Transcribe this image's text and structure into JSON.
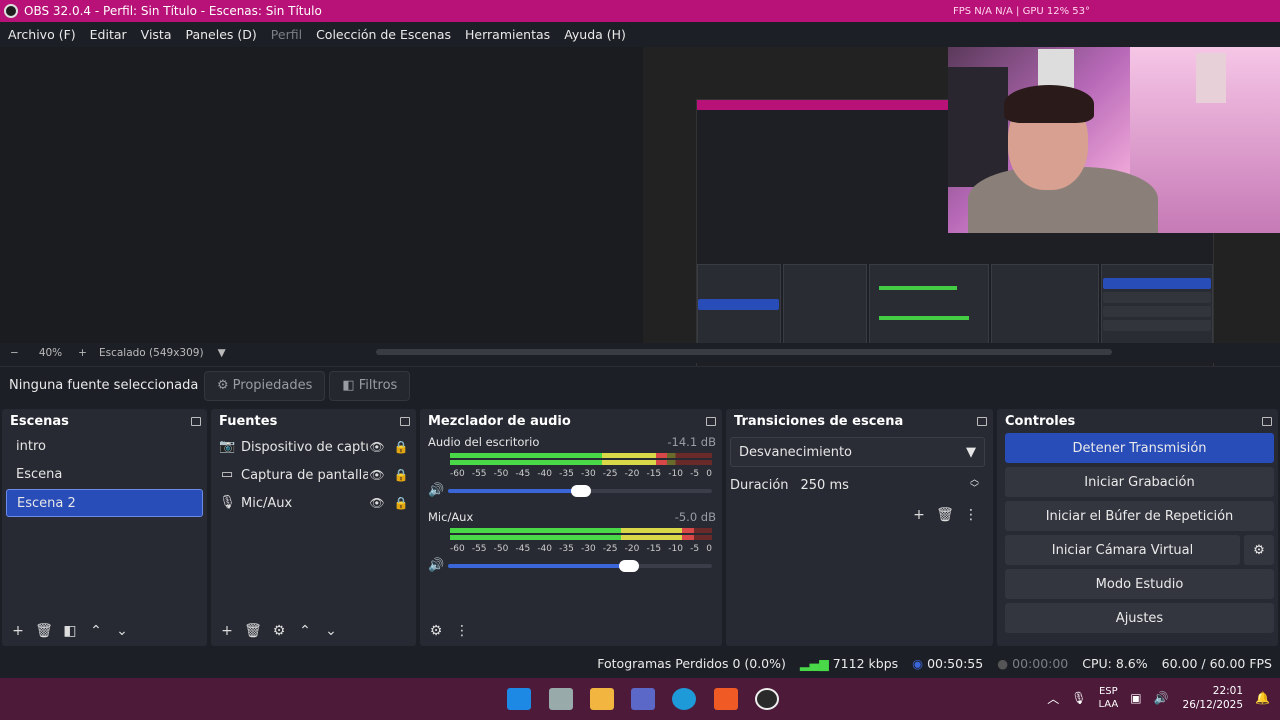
{
  "window": {
    "title": "OBS 32.0.4 - Perfil: Sin Título - Escenas: Sin Título",
    "fps": "FPS N/A N/A | GPU 12% 53°"
  },
  "menu": {
    "items": [
      "Archivo (F)",
      "Editar",
      "Vista",
      "Paneles (D)",
      "Perfil",
      "Colección de Escenas",
      "Herramientas",
      "Ayuda (H)"
    ]
  },
  "preview_bar": {
    "minus": "−",
    "zoom": "40%",
    "plus": "+",
    "scale": "Escalado (549x309)"
  },
  "context": {
    "no_source": "Ninguna fuente seleccionada",
    "properties": "Propiedades",
    "filters": "Filtros"
  },
  "scenes": {
    "title": "Escenas",
    "items": [
      "intro",
      "Escena",
      "Escena 2"
    ],
    "selected": 2
  },
  "sources": {
    "title": "Fuentes",
    "items": [
      {
        "label": "Dispositivo de captura de video",
        "icon": "camera-icon"
      },
      {
        "label": "Captura de pantalla",
        "icon": "monitor-icon"
      },
      {
        "label": "Mic/Aux",
        "icon": "microphone-icon"
      }
    ]
  },
  "mixer": {
    "title": "Mezclador de audio",
    "channels": [
      {
        "name": "Audio del escritorio",
        "db": "-14.1 dB",
        "level": 0.83,
        "volume": 0.56
      },
      {
        "name": "Mic/Aux",
        "db": "-5.0 dB",
        "level": 0.93,
        "volume": 0.76
      }
    ],
    "scale": [
      "-60",
      "-55",
      "-50",
      "-45",
      "-40",
      "-35",
      "-30",
      "-25",
      "-20",
      "-15",
      "-10",
      "-5",
      "0"
    ]
  },
  "transitions": {
    "title": "Transiciones de escena",
    "selected": "Desvanecimiento",
    "duration_label": "Duración",
    "duration": "250 ms"
  },
  "controls": {
    "title": "Controles",
    "buttons": [
      "Detener Transmisión",
      "Iniciar Grabación",
      "Iniciar el Búfer de Repetición",
      "Iniciar Cámara Virtual",
      "Modo Estudio",
      "Ajustes"
    ]
  },
  "status": {
    "dropped": "Fotogramas Perdidos 0 (0.0%)",
    "kbps": "7112 kbps",
    "stream_time": "00:50:55",
    "rec_time": "00:00:00",
    "cpu": "CPU: 8.6%",
    "fps": "60.00 / 60.00 FPS"
  },
  "taskbar": {
    "lang1": "ESP",
    "lang2": "LAA",
    "time": "22:01",
    "date": "26/12/2025"
  },
  "colors": {
    "accent": "#284cb8",
    "titlebar": "#b81177"
  }
}
